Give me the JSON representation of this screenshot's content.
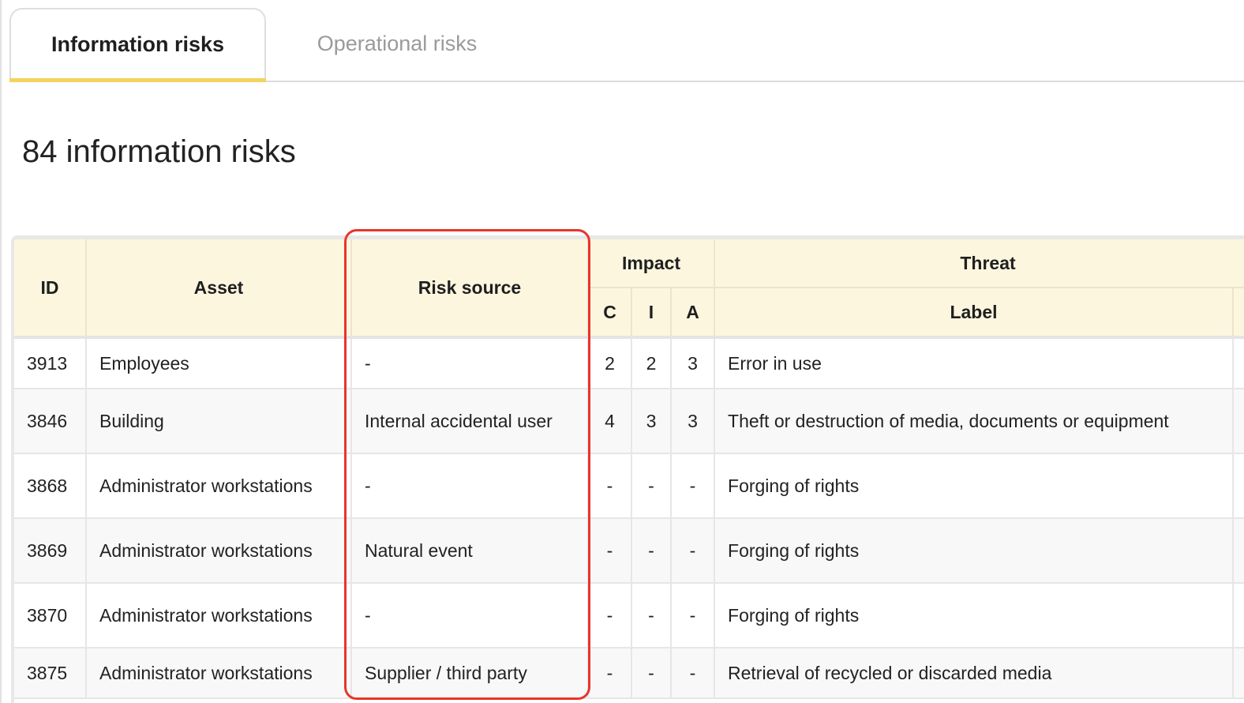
{
  "tabs": [
    {
      "label": "Information risks",
      "active": true
    },
    {
      "label": "Operational risks",
      "active": false
    }
  ],
  "page_title": "84 information risks",
  "table": {
    "headers": {
      "id": "ID",
      "asset": "Asset",
      "risk_source": "Risk source",
      "impact": "Impact",
      "impact_c": "C",
      "impact_i": "I",
      "impact_a": "A",
      "threat": "Threat",
      "threat_label": "Label"
    },
    "rows": [
      {
        "id": "3913",
        "asset": "Employees",
        "risk_source": "-",
        "c": "2",
        "i": "2",
        "a": "3",
        "threat": "Error in use"
      },
      {
        "id": "3846",
        "asset": "Building",
        "risk_source": "Internal accidental user",
        "c": "4",
        "i": "3",
        "a": "3",
        "threat": "Theft or destruction of media, documents or equipment"
      },
      {
        "id": "3868",
        "asset": "Administrator workstations",
        "risk_source": "-",
        "c": "-",
        "i": "-",
        "a": "-",
        "threat": "Forging of rights"
      },
      {
        "id": "3869",
        "asset": "Administrator workstations",
        "risk_source": "Natural event",
        "c": "-",
        "i": "-",
        "a": "-",
        "threat": "Forging of rights"
      },
      {
        "id": "3870",
        "asset": "Administrator workstations",
        "risk_source": "-",
        "c": "-",
        "i": "-",
        "a": "-",
        "threat": "Forging of rights"
      },
      {
        "id": "3875",
        "asset": "Administrator workstations",
        "risk_source": "Supplier / third party",
        "c": "-",
        "i": "-",
        "a": "-",
        "threat": "Retrieval of recycled or discarded media"
      }
    ]
  },
  "colors": {
    "tab_accent": "#f4d35e",
    "header_bg": "#fdf6df",
    "highlight": "#e8352b"
  }
}
